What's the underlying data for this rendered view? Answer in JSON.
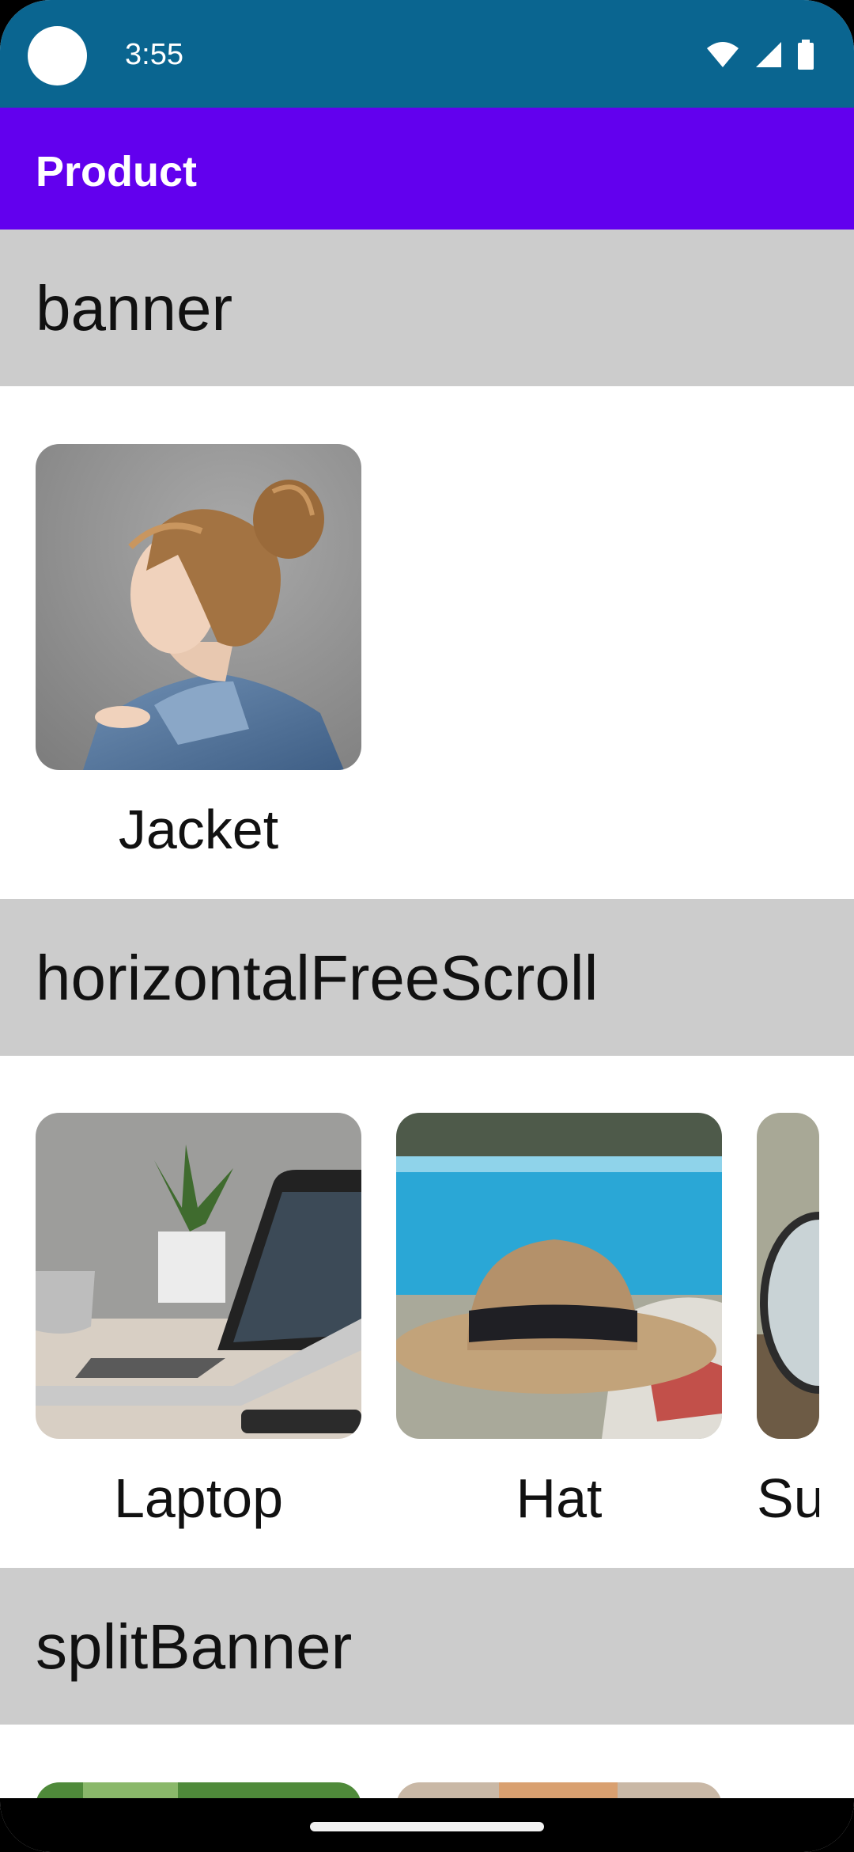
{
  "status_bar": {
    "time": "3:55",
    "icons": [
      "wifi-icon",
      "signal-icon",
      "battery-icon"
    ]
  },
  "app_bar": {
    "title": "Product"
  },
  "sections": [
    {
      "title": "banner",
      "items": [
        {
          "label": "Jacket"
        }
      ]
    },
    {
      "title": "horizontalFreeScroll",
      "items": [
        {
          "label": "Laptop"
        },
        {
          "label": "Hat"
        },
        {
          "label": "Su"
        }
      ]
    },
    {
      "title": "splitBanner",
      "items": []
    }
  ],
  "colors": {
    "status_bar": "#0a6590",
    "app_bar": "#6200ee",
    "section_header": "#cccccc"
  }
}
